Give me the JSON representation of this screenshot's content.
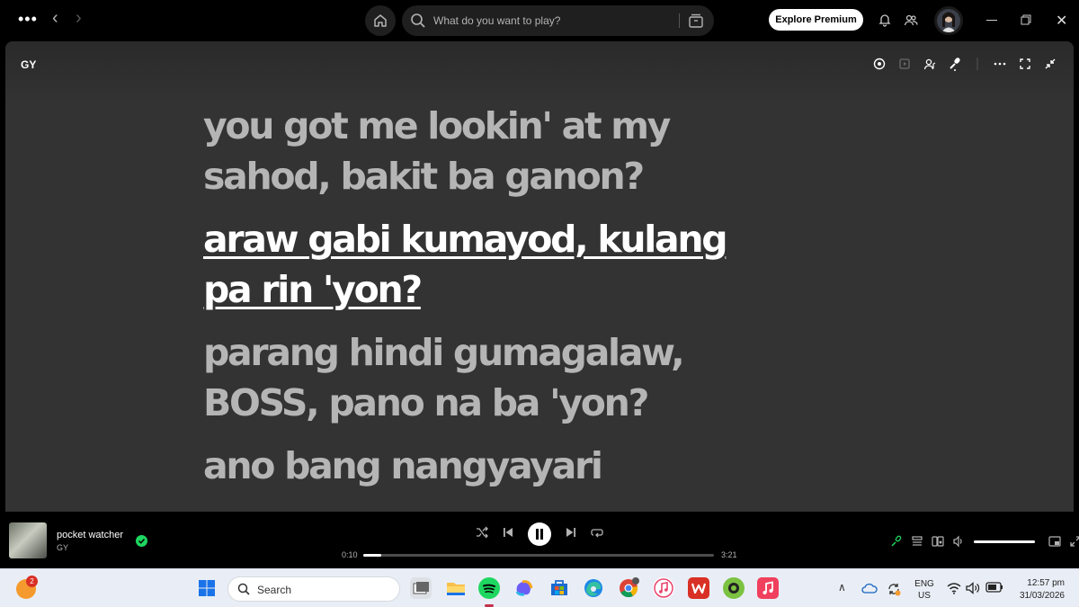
{
  "topbar": {
    "menu_dots": "•••",
    "back_glyph": "‹",
    "forward_glyph": "›",
    "search_placeholder": "What do you want to play?",
    "premium_label": "Explore Premium",
    "icons": [
      "home-icon",
      "search-icon",
      "browse-icon",
      "bell-icon",
      "friends-icon",
      "avatar",
      "minimize-icon",
      "maximize-icon",
      "close-icon"
    ]
  },
  "panel": {
    "artist_title": "GY",
    "icons": [
      "lyrics-sync-icon",
      "video-icon",
      "artist-icon",
      "mic-icon",
      "more-icon",
      "fullscreen-icon",
      "collapse-icon"
    ]
  },
  "lyrics": {
    "lines": [
      "you got me lookin' at my sahod, bakit ba ganon?",
      "araw gabi kumayod, kulang pa rin 'yon?",
      "parang hindi gumagalaw, BOSS, pano na ba 'yon?",
      "ano bang nangyayari"
    ],
    "active_index": 1
  },
  "player": {
    "track_title": "pocket watcher",
    "track_artist": "GY",
    "current_time": "0:10",
    "total_time": "3:21",
    "progress_fraction": 0.05,
    "volume_fraction": 1.0,
    "state": "playing"
  },
  "taskbar": {
    "weather_badge": "2",
    "search_label": "Search",
    "lang_line1": "ENG",
    "lang_line2": "US",
    "time": "12:57 pm",
    "date": "31/03/2026"
  },
  "colors": {
    "accent_green": "#1ed760",
    "panel_bg": "#333333",
    "lyric_inactive": "#b5b5b5",
    "lyric_active": "#ffffff"
  }
}
